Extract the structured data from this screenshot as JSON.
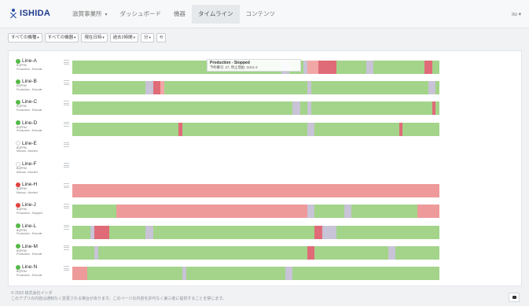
{
  "brand": {
    "name": "ISHIDA"
  },
  "nav": {
    "items": [
      {
        "label": "滋賀事業所",
        "caret": "▾",
        "active": false
      },
      {
        "label": "ダッシュボード",
        "active": false
      },
      {
        "label": "機器",
        "active": false
      },
      {
        "label": "タイムライン",
        "active": true
      },
      {
        "label": "コンテンツ",
        "active": false
      }
    ],
    "user": "ito ▾"
  },
  "filters": [
    {
      "label": "すべての機種",
      "caret": "▾"
    },
    {
      "label": "すべての機器",
      "caret": "▾"
    },
    {
      "label": "現在日時",
      "caret": "▾"
    },
    {
      "label": "過去2時間",
      "caret": "▾"
    },
    {
      "label": "分",
      "caret": "▾"
    },
    {
      "label": "⟲",
      "caret": ""
    }
  ],
  "colors": {
    "production": "#a3d48a",
    "stopped": "#ee9a9a",
    "stopped_dark": "#e06b78",
    "changeover": "#c8c3d6",
    "alarm": "#f2a7a7",
    "status_green": "#54b948",
    "status_red": "#e0423e"
  },
  "lines": [
    {
      "name": "Line-A",
      "status": "green",
      "sub1": "BQPRM",
      "sub2": "Production - Execute",
      "segments": [
        [
          0,
          0.57,
          "production"
        ],
        [
          0.57,
          0.59,
          "changeover"
        ],
        [
          0.59,
          0.63,
          "production"
        ],
        [
          0.63,
          0.64,
          "changeover"
        ],
        [
          0.64,
          0.67,
          "alarm"
        ],
        [
          0.67,
          0.72,
          "stopped_dark"
        ],
        [
          0.72,
          0.8,
          "production"
        ],
        [
          0.8,
          0.82,
          "changeover"
        ],
        [
          0.82,
          0.96,
          "production"
        ],
        [
          0.96,
          0.98,
          "stopped_dark"
        ],
        [
          0.98,
          1,
          "production"
        ]
      ]
    },
    {
      "name": "Line-B",
      "status": "green",
      "sub1": "BQPRM",
      "sub2": "Production - Execute",
      "segments": [
        [
          0,
          0.2,
          "production"
        ],
        [
          0.2,
          0.22,
          "changeover"
        ],
        [
          0.22,
          0.24,
          "stopped_dark"
        ],
        [
          0.24,
          0.25,
          "alarm"
        ],
        [
          0.25,
          0.64,
          "production"
        ],
        [
          0.64,
          0.65,
          "changeover"
        ],
        [
          0.65,
          0.97,
          "production"
        ],
        [
          0.97,
          0.99,
          "changeover"
        ],
        [
          0.99,
          1,
          "production"
        ]
      ]
    },
    {
      "name": "Line-C",
      "status": "green",
      "sub1": "BQPRM",
      "sub2": "Production - Execute",
      "segments": [
        [
          0,
          0.6,
          "production"
        ],
        [
          0.6,
          0.62,
          "changeover"
        ],
        [
          0.62,
          0.64,
          "production"
        ],
        [
          0.64,
          0.65,
          "changeover"
        ],
        [
          0.65,
          0.98,
          "production"
        ],
        [
          0.98,
          0.99,
          "stopped_dark"
        ],
        [
          0.99,
          1,
          "production"
        ]
      ]
    },
    {
      "name": "Line-D",
      "status": "green",
      "sub1": "BQPRM",
      "sub2": "Production - Execute",
      "segments": [
        [
          0,
          0.29,
          "production"
        ],
        [
          0.29,
          0.3,
          "stopped_dark"
        ],
        [
          0.3,
          0.64,
          "production"
        ],
        [
          0.64,
          0.66,
          "changeover"
        ],
        [
          0.66,
          0.89,
          "production"
        ],
        [
          0.89,
          0.9,
          "stopped_dark"
        ],
        [
          0.9,
          1,
          "production"
        ]
      ]
    },
    {
      "name": "Line-E",
      "status": "empty",
      "sub1": "BQPRM",
      "sub2": "Manual - Aborted",
      "segments": []
    },
    {
      "name": "Line-F",
      "status": "empty",
      "sub1": "BQPRM",
      "sub2": "Manual - Aborted",
      "segments": []
    },
    {
      "name": "Line-H",
      "status": "red",
      "sub1": "BQPRM",
      "sub2": "Manual - Aborted",
      "segments": [
        [
          0,
          1,
          "stopped"
        ]
      ]
    },
    {
      "name": "Line-J",
      "status": "red",
      "sub1": "BQPRM",
      "sub2": "Production - Stopped",
      "segments": [
        [
          0,
          0.12,
          "production"
        ],
        [
          0.12,
          0.64,
          "stopped"
        ],
        [
          0.64,
          0.66,
          "changeover"
        ],
        [
          0.66,
          0.74,
          "production"
        ],
        [
          0.74,
          0.76,
          "changeover"
        ],
        [
          0.76,
          0.94,
          "production"
        ],
        [
          0.94,
          1,
          "stopped"
        ]
      ]
    },
    {
      "name": "Line-L",
      "status": "green",
      "sub1": "BQPRM",
      "sub2": "Production - Execute",
      "segments": [
        [
          0,
          0.05,
          "production"
        ],
        [
          0.05,
          0.06,
          "changeover"
        ],
        [
          0.06,
          0.1,
          "stopped_dark"
        ],
        [
          0.1,
          0.2,
          "production"
        ],
        [
          0.2,
          0.22,
          "changeover"
        ],
        [
          0.22,
          0.66,
          "production"
        ],
        [
          0.66,
          0.68,
          "stopped_dark"
        ],
        [
          0.68,
          0.72,
          "changeover"
        ],
        [
          0.72,
          1,
          "production"
        ]
      ]
    },
    {
      "name": "Line-M",
      "status": "green",
      "sub1": "BQPRM",
      "sub2": "Production - Execute",
      "segments": [
        [
          0,
          0.06,
          "production"
        ],
        [
          0.06,
          0.07,
          "changeover"
        ],
        [
          0.07,
          0.64,
          "production"
        ],
        [
          0.64,
          0.66,
          "stopped_dark"
        ],
        [
          0.66,
          0.86,
          "production"
        ],
        [
          0.86,
          0.88,
          "changeover"
        ],
        [
          0.88,
          1,
          "production"
        ]
      ]
    },
    {
      "name": "Line-N",
      "status": "green",
      "sub1": "BQPRM",
      "sub2": "Production - Execute",
      "segments": [
        [
          0,
          0.04,
          "stopped"
        ],
        [
          0.04,
          0.3,
          "production"
        ],
        [
          0.3,
          0.31,
          "changeover"
        ],
        [
          0.31,
          0.58,
          "production"
        ],
        [
          0.58,
          0.6,
          "changeover"
        ],
        [
          0.6,
          1,
          "production"
        ]
      ]
    }
  ],
  "tooltip": {
    "title": "Production - Stopped",
    "body": "予約番号: 27, 停止理由: 11111-2"
  },
  "footer": {
    "line1": "© 2022 株式会社イシダ",
    "line2": "このアプリの内容は通知なく変更される場合があります。このページの内容を許可なく第三者に提供することを禁じます。"
  }
}
